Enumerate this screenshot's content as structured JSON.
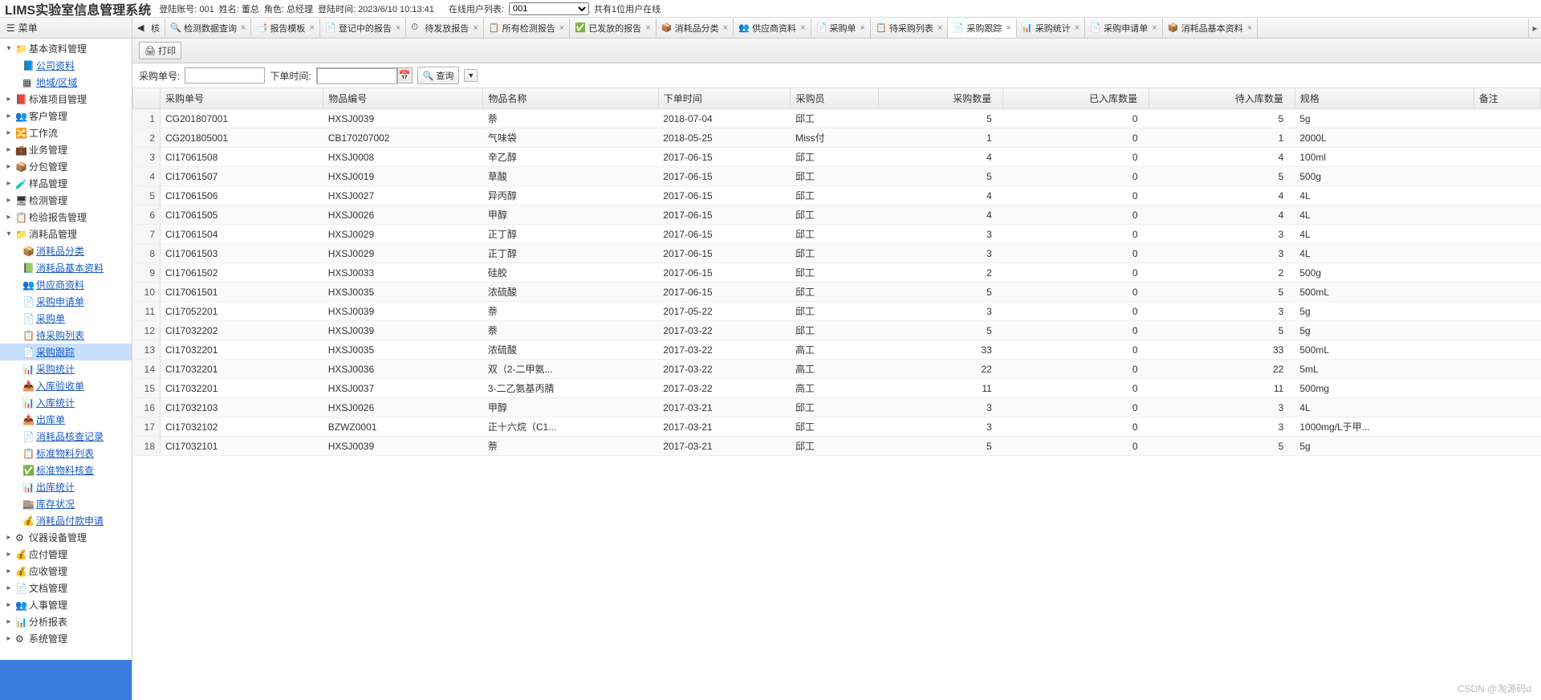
{
  "header": {
    "app_title": "LIMS实验室信息管理系统",
    "account_label": "登陆账号: 001",
    "name_label": "姓名: 董总",
    "role_label": "角色: 总经理",
    "login_time_label": "登陆时间: 2023/6/10 10:13:41",
    "online_label": "在线用户列表:",
    "online_selected": "001",
    "online_count": "共有1位用户在线"
  },
  "sidebar": {
    "title": "菜单",
    "nodes": [
      {
        "label": "基本资料管理",
        "depth": 1,
        "expanded": true,
        "icon": "folder",
        "link": false
      },
      {
        "label": "公司资料",
        "depth": 2,
        "icon": "doc-blue",
        "link": true
      },
      {
        "label": "地域/区域",
        "depth": 2,
        "icon": "grid",
        "link": true
      },
      {
        "label": "标准项目管理",
        "depth": 1,
        "expanded": false,
        "icon": "book",
        "link": false
      },
      {
        "label": "客户管理",
        "depth": 1,
        "expanded": false,
        "icon": "users",
        "link": false
      },
      {
        "label": "工作流",
        "depth": 1,
        "expanded": false,
        "icon": "flow",
        "link": false
      },
      {
        "label": "业务管理",
        "depth": 1,
        "expanded": false,
        "icon": "briefcase",
        "link": false
      },
      {
        "label": "分包管理",
        "depth": 1,
        "expanded": false,
        "icon": "package",
        "link": false
      },
      {
        "label": "样品管理",
        "depth": 1,
        "expanded": false,
        "icon": "flask",
        "link": false
      },
      {
        "label": "检测管理",
        "depth": 1,
        "expanded": false,
        "icon": "monitor",
        "link": false
      },
      {
        "label": "检验报告管理",
        "depth": 1,
        "expanded": false,
        "icon": "report",
        "link": false
      },
      {
        "label": "消耗品管理",
        "depth": 1,
        "expanded": true,
        "icon": "folder",
        "link": false
      },
      {
        "label": "消耗品分类",
        "depth": 2,
        "icon": "box-yellow",
        "link": true
      },
      {
        "label": "消耗品基本资料",
        "depth": 2,
        "icon": "box-green",
        "link": true
      },
      {
        "label": "供应商资料",
        "depth": 2,
        "icon": "users",
        "link": true
      },
      {
        "label": "采购申请单",
        "depth": 2,
        "icon": "doc",
        "link": true
      },
      {
        "label": "采购单",
        "depth": 2,
        "icon": "doc",
        "link": true
      },
      {
        "label": "待采购列表",
        "depth": 2,
        "icon": "list",
        "link": true
      },
      {
        "label": "采购跟踪",
        "depth": 2,
        "icon": "doc",
        "link": true,
        "selected": true
      },
      {
        "label": "采购统计",
        "depth": 2,
        "icon": "chart",
        "link": true
      },
      {
        "label": "入库验收单",
        "depth": 2,
        "icon": "in",
        "link": true
      },
      {
        "label": "入库统计",
        "depth": 2,
        "icon": "chart",
        "link": true
      },
      {
        "label": "出库单",
        "depth": 2,
        "icon": "out",
        "link": true
      },
      {
        "label": "消耗品核查记录",
        "depth": 2,
        "icon": "doc",
        "link": true
      },
      {
        "label": "标准物料列表",
        "depth": 2,
        "icon": "list",
        "link": true
      },
      {
        "label": "标准物料核查",
        "depth": 2,
        "icon": "check",
        "link": true
      },
      {
        "label": "出库统计",
        "depth": 2,
        "icon": "chart",
        "link": true
      },
      {
        "label": "库存状况",
        "depth": 2,
        "icon": "store",
        "link": true
      },
      {
        "label": "消耗品付款申请",
        "depth": 2,
        "icon": "money",
        "link": true
      },
      {
        "label": "仪器设备管理",
        "depth": 1,
        "expanded": false,
        "icon": "device",
        "link": false
      },
      {
        "label": "应付管理",
        "depth": 1,
        "expanded": false,
        "icon": "money",
        "link": false
      },
      {
        "label": "应收管理",
        "depth": 1,
        "expanded": false,
        "icon": "money",
        "link": false
      },
      {
        "label": "文档管理",
        "depth": 1,
        "expanded": false,
        "icon": "doc",
        "link": false
      },
      {
        "label": "人事管理",
        "depth": 1,
        "expanded": false,
        "icon": "users",
        "link": false
      },
      {
        "label": "分析报表",
        "depth": 1,
        "expanded": false,
        "icon": "chart",
        "link": false
      },
      {
        "label": "系统管理",
        "depth": 1,
        "expanded": false,
        "icon": "gear",
        "link": false
      }
    ]
  },
  "tabs": [
    {
      "label": "核",
      "icon": "left",
      "closable": false
    },
    {
      "label": "检测数据查询",
      "icon": "search",
      "closable": true
    },
    {
      "label": "报告模板",
      "icon": "tpl",
      "closable": true
    },
    {
      "label": "登记中的报告",
      "icon": "doc",
      "closable": true
    },
    {
      "label": "待发放报告",
      "icon": "clock",
      "closable": true
    },
    {
      "label": "所有检测报告",
      "icon": "report",
      "closable": true
    },
    {
      "label": "已发放的报告",
      "icon": "check",
      "closable": true
    },
    {
      "label": "消耗品分类",
      "icon": "box",
      "closable": true
    },
    {
      "label": "供应商资料",
      "icon": "users",
      "closable": true
    },
    {
      "label": "采购单",
      "icon": "doc",
      "closable": true
    },
    {
      "label": "待采购列表",
      "icon": "list",
      "closable": true
    },
    {
      "label": "采购跟踪",
      "icon": "doc",
      "closable": true,
      "active": true
    },
    {
      "label": "采购统计",
      "icon": "chart",
      "closable": true
    },
    {
      "label": "采购申请单",
      "icon": "doc",
      "closable": true
    },
    {
      "label": "消耗品基本资料",
      "icon": "box",
      "closable": true
    }
  ],
  "toolbar": {
    "print": "打印"
  },
  "search": {
    "po_label": "采购单号:",
    "date_label": "下单时间:",
    "query": "查询"
  },
  "columns": [
    "",
    "采购单号",
    "物品编号",
    "物品名称",
    "下单时间",
    "采购员",
    "采购数量",
    "已入库数量",
    "待入库数量",
    "规格",
    "备注"
  ],
  "rows": [
    [
      "1",
      "CG201807001",
      "HXSJ0039",
      "萘",
      "2018-07-04",
      "邱工",
      "5",
      "0",
      "5",
      "5g",
      ""
    ],
    [
      "2",
      "CG201805001",
      "CB170207002",
      "气味袋",
      "2018-05-25",
      "Miss付",
      "1",
      "0",
      "1",
      "2000L",
      ""
    ],
    [
      "3",
      "CI17061508",
      "HXSJ0008",
      "辛乙醇",
      "2017-06-15",
      "邱工",
      "4",
      "0",
      "4",
      "100ml",
      ""
    ],
    [
      "4",
      "CI17061507",
      "HXSJ0019",
      "草酸",
      "2017-06-15",
      "邱工",
      "5",
      "0",
      "5",
      "500g",
      ""
    ],
    [
      "5",
      "CI17061506",
      "HXSJ0027",
      "异丙醇",
      "2017-06-15",
      "邱工",
      "4",
      "0",
      "4",
      "4L",
      ""
    ],
    [
      "6",
      "CI17061505",
      "HXSJ0026",
      "甲醇",
      "2017-06-15",
      "邱工",
      "4",
      "0",
      "4",
      "4L",
      ""
    ],
    [
      "7",
      "CI17061504",
      "HXSJ0029",
      "正丁醇",
      "2017-06-15",
      "邱工",
      "3",
      "0",
      "3",
      "4L",
      ""
    ],
    [
      "8",
      "CI17061503",
      "HXSJ0029",
      "正丁醇",
      "2017-06-15",
      "邱工",
      "3",
      "0",
      "3",
      "4L",
      ""
    ],
    [
      "9",
      "CI17061502",
      "HXSJ0033",
      "硅胶",
      "2017-06-15",
      "邱工",
      "2",
      "0",
      "2",
      "500g",
      ""
    ],
    [
      "10",
      "CI17061501",
      "HXSJ0035",
      "浓硫酸",
      "2017-06-15",
      "邱工",
      "5",
      "0",
      "5",
      "500mL",
      ""
    ],
    [
      "11",
      "CI17052201",
      "HXSJ0039",
      "萘",
      "2017-05-22",
      "邱工",
      "3",
      "0",
      "3",
      "5g",
      ""
    ],
    [
      "12",
      "CI17032202",
      "HXSJ0039",
      "萘",
      "2017-03-22",
      "邱工",
      "5",
      "0",
      "5",
      "5g",
      ""
    ],
    [
      "13",
      "CI17032201",
      "HXSJ0035",
      "浓硫酸",
      "2017-03-22",
      "高工",
      "33",
      "0",
      "33",
      "500mL",
      ""
    ],
    [
      "14",
      "CI17032201",
      "HXSJ0036",
      "双（2-二甲氨...",
      "2017-03-22",
      "高工",
      "22",
      "0",
      "22",
      "5mL",
      ""
    ],
    [
      "15",
      "CI17032201",
      "HXSJ0037",
      "3-二乙氨基丙腈",
      "2017-03-22",
      "高工",
      "11",
      "0",
      "11",
      "500mg",
      ""
    ],
    [
      "16",
      "CI17032103",
      "HXSJ0026",
      "甲醇",
      "2017-03-21",
      "邱工",
      "3",
      "0",
      "3",
      "4L",
      ""
    ],
    [
      "17",
      "CI17032102",
      "BZWZ0001",
      "正十六烷（C1...",
      "2017-03-21",
      "邱工",
      "3",
      "0",
      "3",
      "1000mg/L于甲...",
      ""
    ],
    [
      "18",
      "CI17032101",
      "HXSJ0039",
      "萘",
      "2017-03-21",
      "邱工",
      "5",
      "0",
      "5",
      "5g",
      ""
    ]
  ],
  "watermark": "CSDN @淘源码d"
}
